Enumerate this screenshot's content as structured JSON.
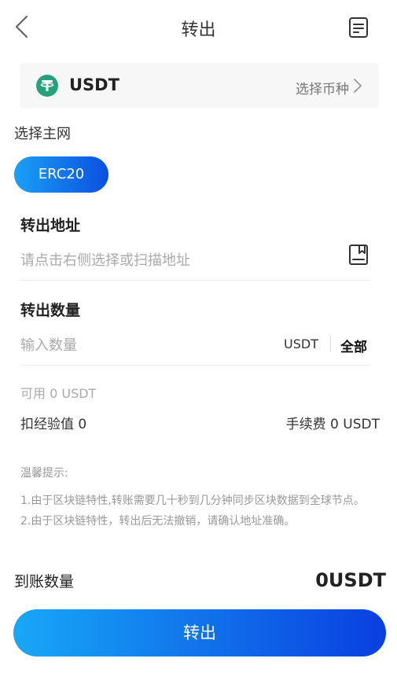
{
  "header": {
    "title": "转出",
    "back_icon": "chevron-left-icon",
    "record_icon": "record-list-icon"
  },
  "coin": {
    "name": "USDT",
    "logo_icon": "tether-logo",
    "logo_color": "#26a17b",
    "select_label": "选择币种",
    "chevron_icon": "chevron-right-icon"
  },
  "network": {
    "label": "选择主网",
    "selected": "ERC20"
  },
  "address": {
    "title": "转出地址",
    "value": "",
    "placeholder": "请点击右侧选择或扫描地址",
    "book_icon": "address-book-icon"
  },
  "amount": {
    "title": "转出数量",
    "value": "",
    "placeholder": "输入数量",
    "unit": "USDT",
    "all_label": "全部"
  },
  "balance": {
    "available": "可用 0 USDT",
    "deduct": "扣经验值 0",
    "fee": "手续费 0 USDT"
  },
  "tips": {
    "title": "温馨提示:",
    "line1": "1.由于区块链特性,转账需要几十秒到几分钟同步区块数据到全球节点。",
    "line2": "2.由于区块链特性，转出后无法撤销，请确认地址准确。"
  },
  "receive": {
    "label": "到账数量",
    "value": "0USDT"
  },
  "submit": {
    "label": "转出"
  },
  "colors": {
    "accent_start": "#1aa0f5",
    "accent_end": "#0b4fe0"
  }
}
